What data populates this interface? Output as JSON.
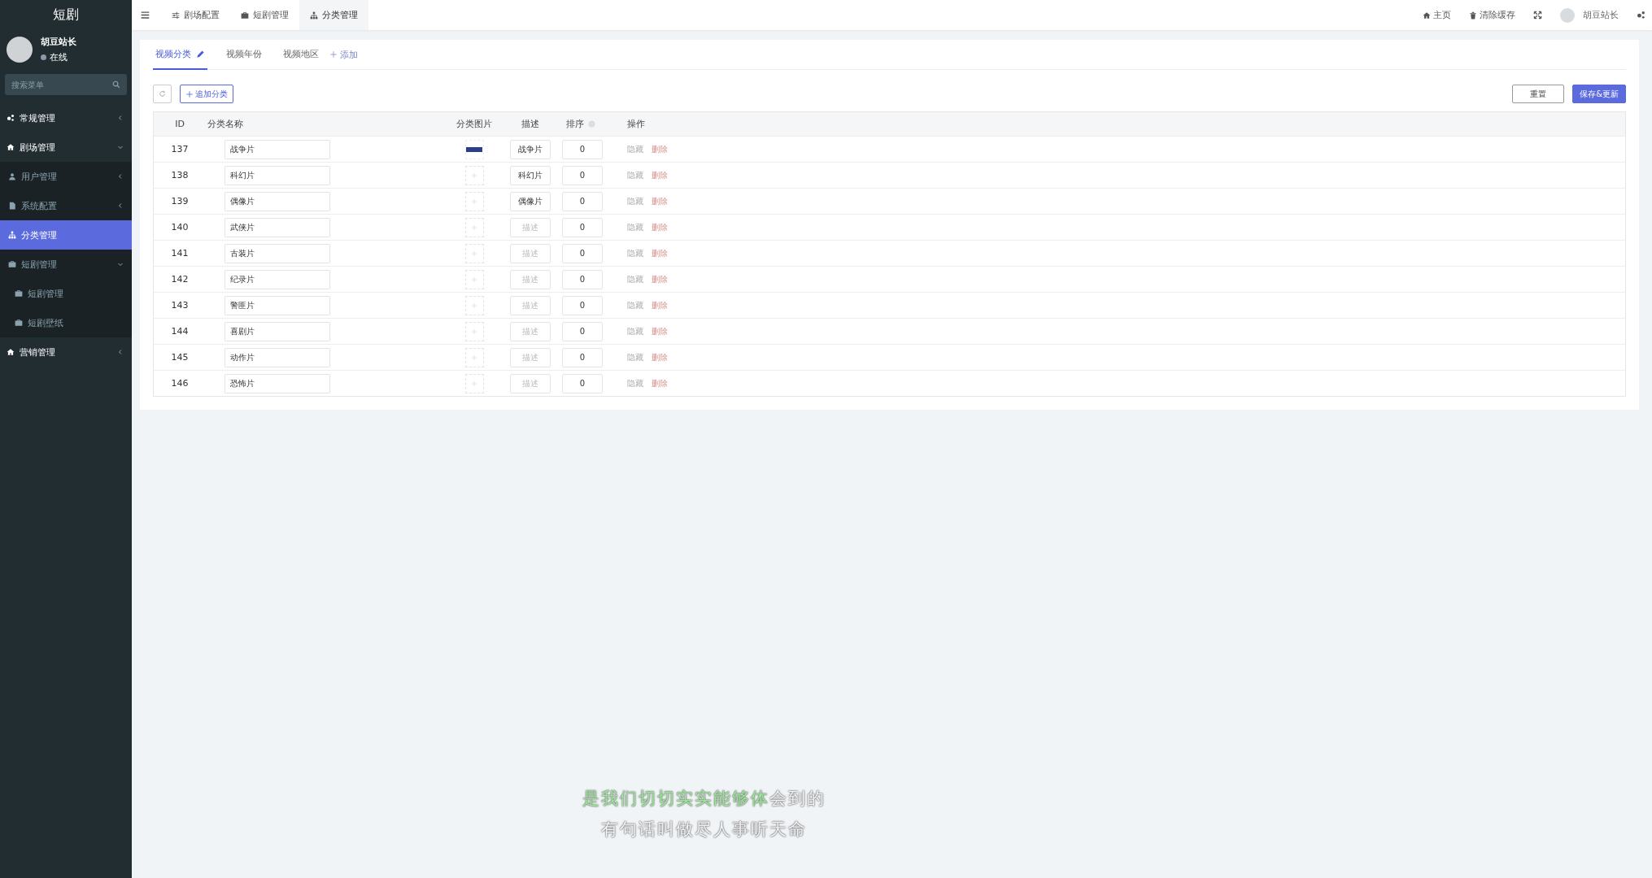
{
  "sidebar": {
    "title": "短剧",
    "user": {
      "name": "胡豆站长",
      "status": "在线"
    },
    "search": {
      "placeholder": "搜索菜单"
    },
    "items": [
      {
        "label": "常规管理",
        "kind": "gears",
        "expanded": false,
        "selected": false
      },
      {
        "label": "剧场管理",
        "kind": "home",
        "expanded": true,
        "selected": false,
        "children": [
          {
            "label": "用户管理",
            "kind": "user",
            "expanded": false,
            "selected": false
          },
          {
            "label": "系统配置",
            "kind": "file",
            "expanded": false,
            "selected": false
          },
          {
            "label": "分类管理",
            "kind": "sitemap",
            "selected": true
          },
          {
            "label": "短剧管理",
            "kind": "bag",
            "expanded": true,
            "selected": false,
            "children": [
              {
                "label": "短剧管理",
                "kind": "bag",
                "selected": false
              },
              {
                "label": "短剧壁纸",
                "kind": "bag",
                "selected": false
              }
            ]
          }
        ]
      },
      {
        "label": "营销管理",
        "kind": "home",
        "expanded": false,
        "selected": false
      }
    ]
  },
  "top_bar": {
    "tabs": [
      {
        "label": "剧场配置",
        "kind": "sliders",
        "selected": false
      },
      {
        "label": "短剧管理",
        "kind": "bag",
        "selected": false
      },
      {
        "label": "分类管理",
        "kind": "sitemap",
        "selected": true
      }
    ],
    "links": [
      {
        "label": "主页",
        "kind": "home"
      },
      {
        "label": "清除缓存",
        "kind": "trash"
      }
    ],
    "user": {
      "name": "胡豆站长"
    }
  },
  "content_tabs": [
    {
      "label": "视频分类",
      "selected": true,
      "editable": true
    },
    {
      "label": "视频年份",
      "selected": false,
      "editable": false
    },
    {
      "label": "视频地区",
      "selected": false,
      "editable": false
    }
  ],
  "add_tab": "添加",
  "toolbar": {
    "add_button": "追加分类",
    "reset_button": "重置",
    "save_button": "保存&更新"
  },
  "table": {
    "columns": [
      {
        "label": "ID"
      },
      {
        "label": "分类名称"
      },
      {
        "label": "分类图片"
      },
      {
        "label": "描述"
      },
      {
        "label": "排序",
        "help": true
      },
      {
        "label": "操作"
      }
    ],
    "rows": [
      {
        "id": "137",
        "name": "战争片",
        "image": true,
        "description": "战争片",
        "sort": "0",
        "hide": "隐藏",
        "delete": "删除"
      },
      {
        "id": "138",
        "name": "科幻片",
        "image": false,
        "description": "科幻片",
        "sort": "0",
        "hide": "隐藏",
        "delete": "删除"
      },
      {
        "id": "139",
        "name": "偶像片",
        "image": false,
        "description": "偶像片",
        "sort": "0",
        "hide": "隐藏",
        "delete": "删除"
      },
      {
        "id": "140",
        "name": "武侠片",
        "image": false,
        "description_placeholder": "描述",
        "sort": "0",
        "hide": "隐藏",
        "delete": "删除"
      },
      {
        "id": "141",
        "name": "古装片",
        "image": false,
        "description_placeholder": "描述",
        "sort": "0",
        "hide": "隐藏",
        "delete": "删除"
      },
      {
        "id": "142",
        "name": "纪录片",
        "image": false,
        "description_placeholder": "描述",
        "sort": "0",
        "hide": "隐藏",
        "delete": "删除"
      },
      {
        "id": "143",
        "name": "警匪片",
        "image": false,
        "description_placeholder": "描述",
        "sort": "0",
        "hide": "隐藏",
        "delete": "删除"
      },
      {
        "id": "144",
        "name": "喜剧片",
        "image": false,
        "description_placeholder": "描述",
        "sort": "0",
        "hide": "隐藏",
        "delete": "删除"
      },
      {
        "id": "145",
        "name": "动作片",
        "image": false,
        "description_placeholder": "描述",
        "sort": "0",
        "hide": "隐藏",
        "delete": "删除"
      },
      {
        "id": "146",
        "name": "恐怖片",
        "image": false,
        "description_placeholder": "描述",
        "sort": "0",
        "hide": "隐藏",
        "delete": "删除"
      }
    ]
  },
  "subtitles": [
    {
      "highlighted": "是我们切切实实能够体",
      "rest": "会到的"
    },
    {
      "rest": "有句话叫做尽人事听天命"
    }
  ]
}
